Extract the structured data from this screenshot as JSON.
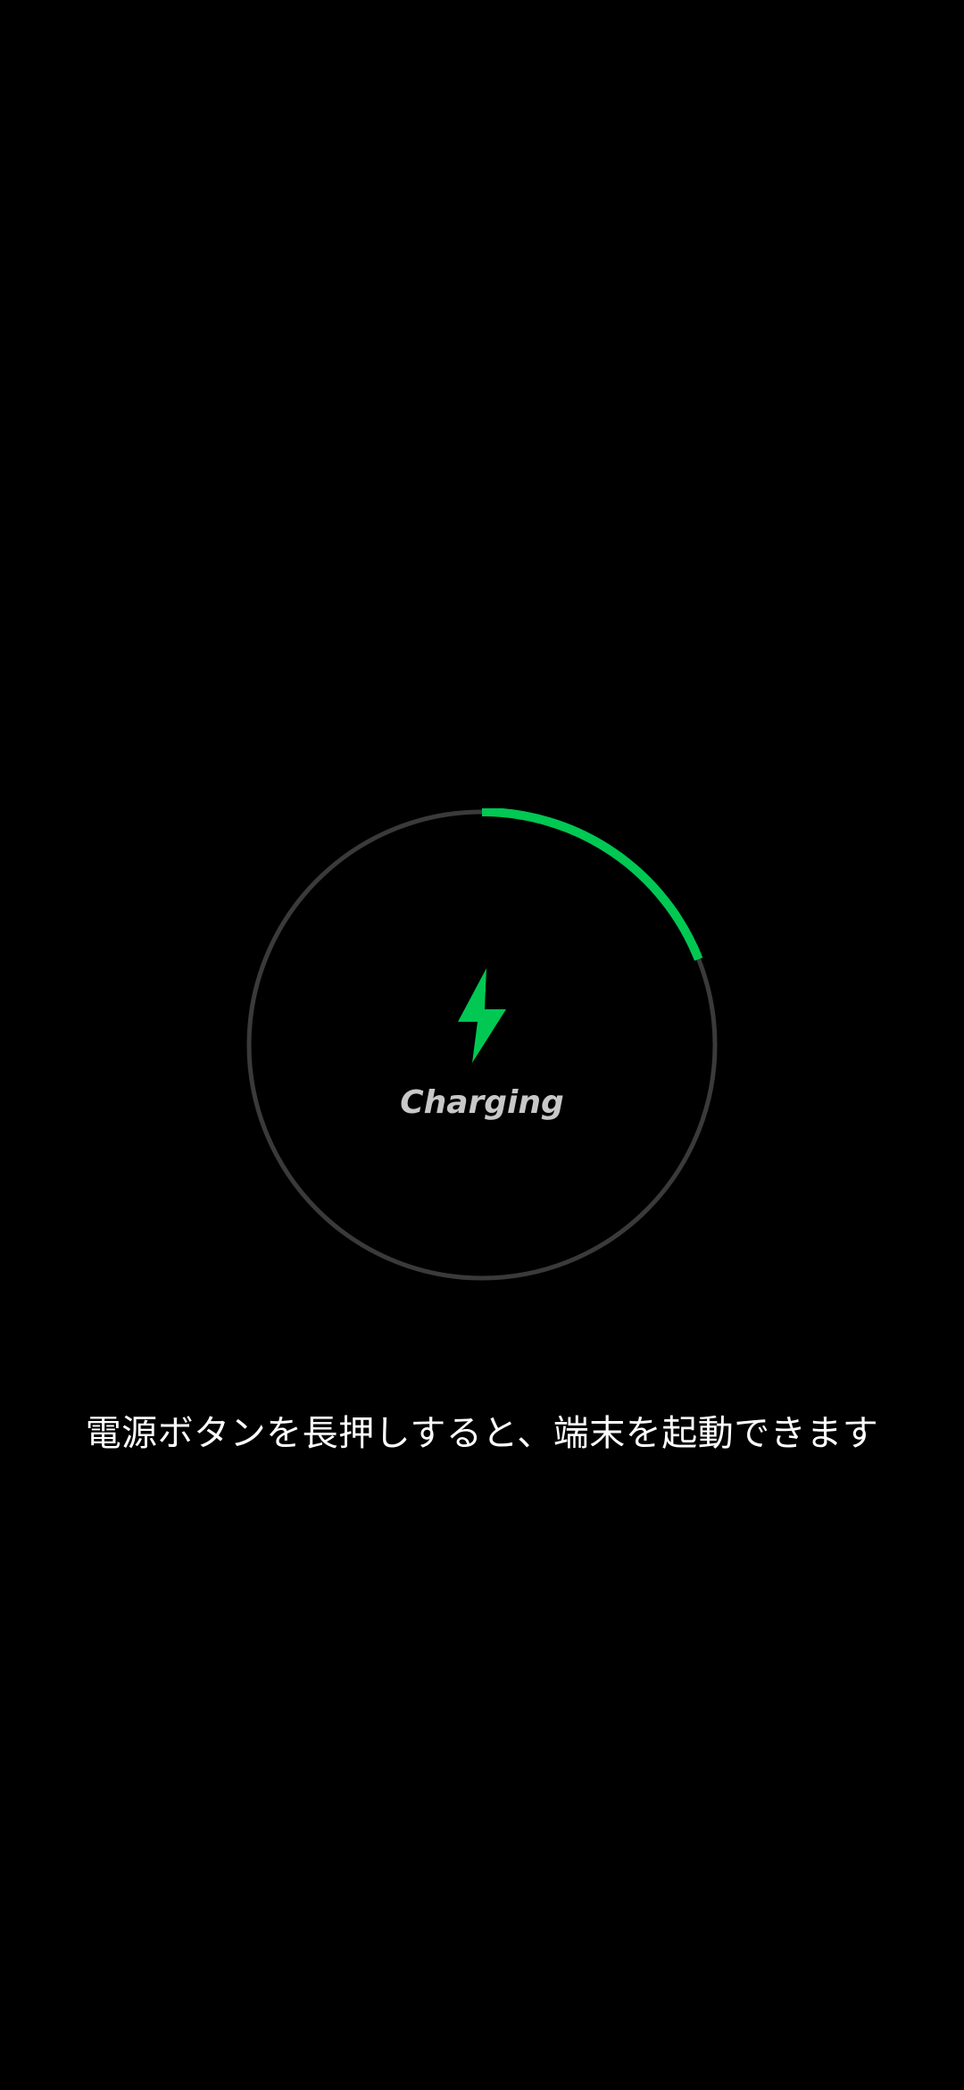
{
  "charging": {
    "status_label": "Charging",
    "level_fraction": 0.19,
    "icon": "lightning-bolt-icon",
    "progress_color": "#00c853",
    "track_color": "#3a3a3a",
    "icon_color": "#00c853"
  },
  "hint": {
    "text": "電源ボタンを長押しすると、端末を起動できます"
  }
}
